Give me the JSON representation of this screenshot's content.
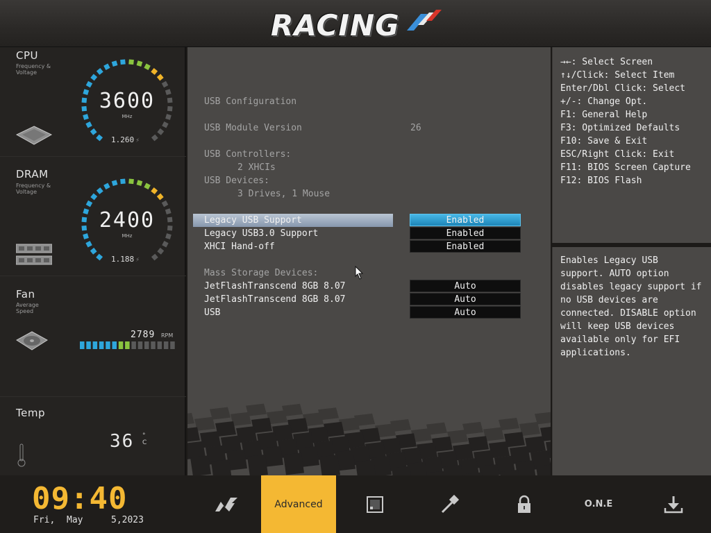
{
  "header": {
    "logo": "RACING"
  },
  "sidebar": {
    "cpu": {
      "title": "CPU",
      "sub1": "Frequency &",
      "sub2": "Voltage",
      "value": "3600",
      "unit": "MHz",
      "voltage": "1.260"
    },
    "dram": {
      "title": "DRAM",
      "sub1": "Frequency &",
      "sub2": "Voltage",
      "value": "2400",
      "unit": "MHz",
      "voltage": "1.188"
    },
    "fan": {
      "title": "Fan",
      "sub1": "Average",
      "sub2": "Speed",
      "value": "2789",
      "unit": "RPM"
    },
    "temp": {
      "title": "Temp",
      "value": "36",
      "unit": "°C"
    }
  },
  "main": {
    "usb_config": "USB Configuration",
    "module_label": "USB Module Version",
    "module_value": "26",
    "controllers_label": "USB Controllers:",
    "controllers_value": "2 XHCIs",
    "devices_label": "USB Devices:",
    "devices_value": "3 Drives, 1 Mouse",
    "settings": [
      {
        "label": "Legacy USB Support",
        "value": "Enabled"
      },
      {
        "label": "Legacy USB3.0 Support",
        "value": "Enabled"
      },
      {
        "label": "XHCI Hand-off",
        "value": "Enabled"
      }
    ],
    "mass_storage_label": "Mass Storage Devices:",
    "mass_storage": [
      {
        "label": "JetFlashTranscend 8GB 8.07",
        "value": "Auto"
      },
      {
        "label": "JetFlashTranscend 8GB 8.07",
        "value": "Auto"
      },
      {
        "label": "USB",
        "value": "Auto"
      }
    ]
  },
  "help": {
    "keys": [
      "→←: Select Screen",
      "↑↓/Click: Select Item",
      "Enter/Dbl Click: Select",
      "+/-: Change Opt.",
      "F1: General Help",
      "F3: Optimized Defaults",
      "F10: Save & Exit",
      "ESC/Right Click: Exit",
      "F11: BIOS Screen Capture",
      "F12: BIOS Flash"
    ],
    "description": "Enables Legacy USB support. AUTO option disables legacy support if no USB devices are connected. DISABLE option will keep USB devices available only for EFI applications."
  },
  "footer": {
    "time": "09:40",
    "day": "Fri,",
    "month": "May",
    "date": "5,2023",
    "nav": [
      {
        "label": "",
        "icon": "main-icon"
      },
      {
        "label": "Advanced",
        "icon": ""
      },
      {
        "label": "",
        "icon": "chip-icon"
      },
      {
        "label": "",
        "icon": "tool-icon"
      },
      {
        "label": "",
        "icon": "lock-icon"
      },
      {
        "label": "O.N.E",
        "icon": ""
      },
      {
        "label": "",
        "icon": "download-icon"
      }
    ],
    "active_nav": "Advanced"
  },
  "colors": {
    "accent": "#f4b833",
    "selected_option": "#2a9ad0",
    "panel": "#4a4846"
  },
  "fan_level": 0.55
}
